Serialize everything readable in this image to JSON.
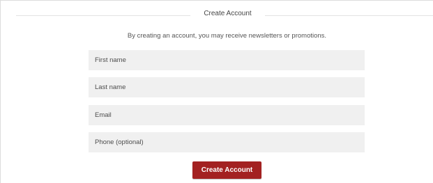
{
  "form": {
    "title": "Create Account",
    "notice": "By creating an account, you may receive newsletters or promotions.",
    "fields": [
      {
        "placeholder": "First name",
        "value": ""
      },
      {
        "placeholder": "Last name",
        "value": ""
      },
      {
        "placeholder": "Email",
        "value": ""
      },
      {
        "placeholder": "Phone (optional)",
        "value": ""
      }
    ],
    "submit_label": "Create Account"
  },
  "colors": {
    "accent": "#a32121",
    "field_background": "#f0f0f0",
    "divider": "#e2e2e2"
  }
}
